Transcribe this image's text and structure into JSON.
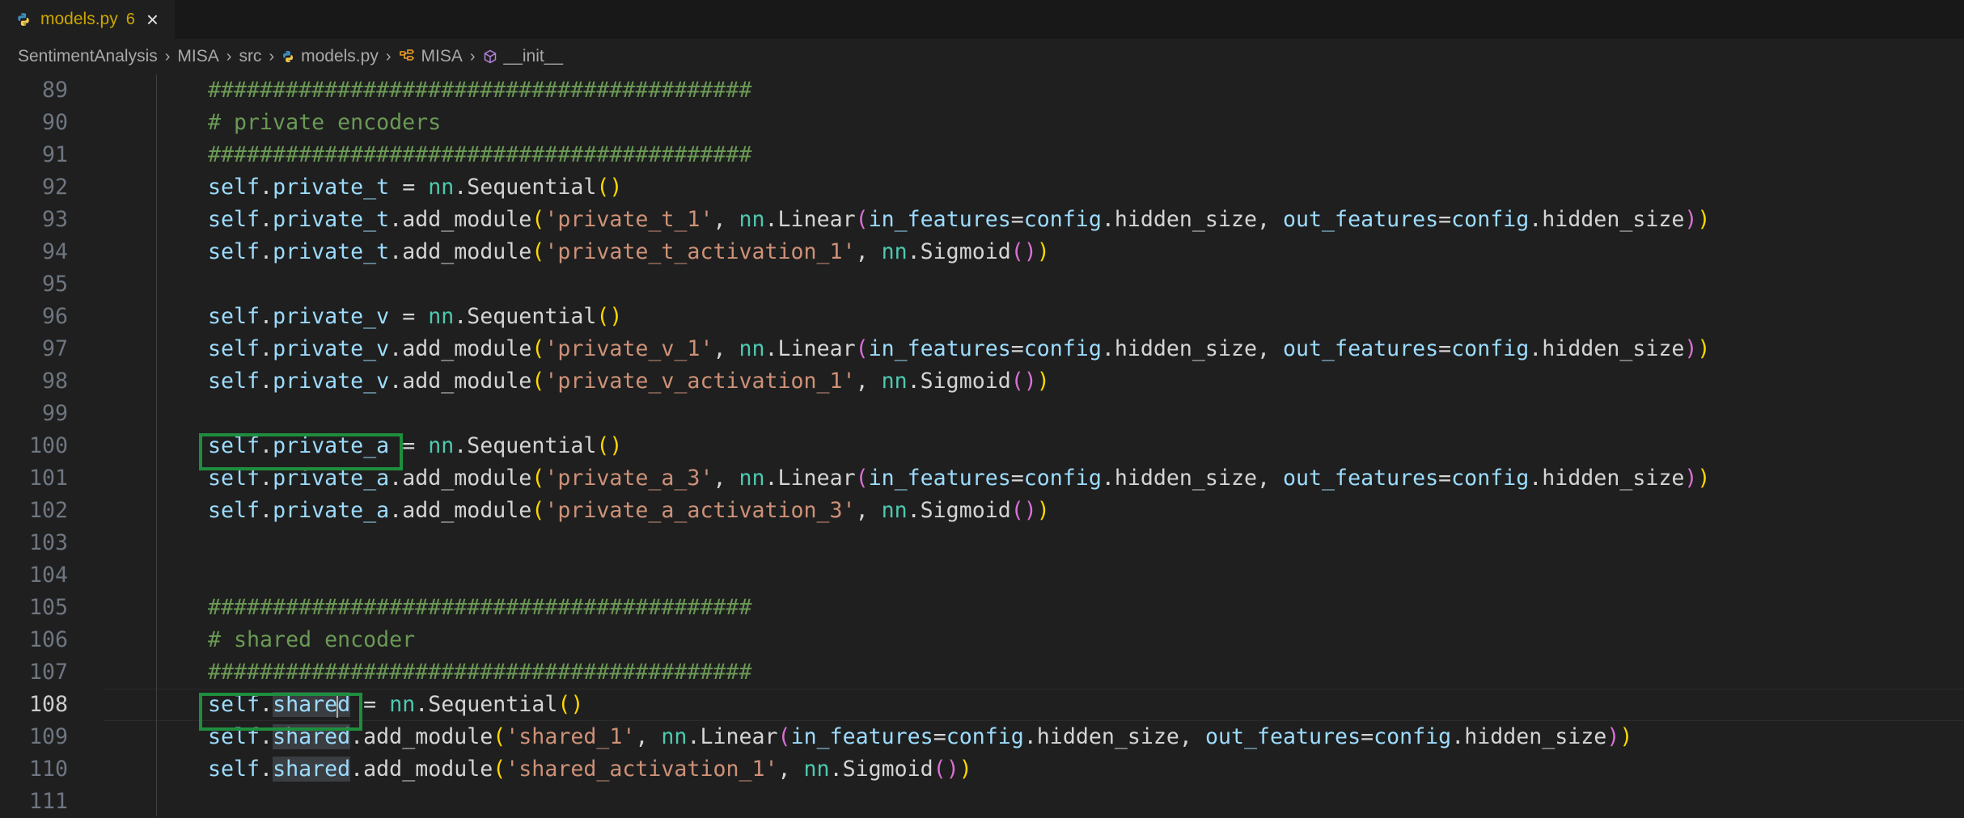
{
  "tab": {
    "file_name": "models.py",
    "problem_count": "6",
    "close_icon": "close-icon",
    "file_icon": "python-file-icon"
  },
  "breadcrumb": {
    "items": [
      "SentimentAnalysis",
      "MISA",
      "src",
      "models.py",
      "MISA",
      "__init__"
    ],
    "icons": [
      "",
      "",
      "",
      "python-file-icon",
      "class-icon",
      "method-icon"
    ]
  },
  "editor": {
    "current_line": 108,
    "lines": [
      {
        "num": "89",
        "text": "##########################################"
      },
      {
        "num": "90",
        "text": "# private encoders"
      },
      {
        "num": "91",
        "text": "##########################################"
      },
      {
        "num": "92",
        "text": "self.private_t = nn.Sequential()"
      },
      {
        "num": "93",
        "text": "self.private_t.add_module('private_t_1', nn.Linear(in_features=config.hidden_size, out_features=config.hidden_size))"
      },
      {
        "num": "94",
        "text": "self.private_t.add_module('private_t_activation_1', nn.Sigmoid())"
      },
      {
        "num": "95",
        "text": ""
      },
      {
        "num": "96",
        "text": "self.private_v = nn.Sequential()"
      },
      {
        "num": "97",
        "text": "self.private_v.add_module('private_v_1', nn.Linear(in_features=config.hidden_size, out_features=config.hidden_size))"
      },
      {
        "num": "98",
        "text": "self.private_v.add_module('private_v_activation_1', nn.Sigmoid())"
      },
      {
        "num": "99",
        "text": ""
      },
      {
        "num": "100",
        "text": "self.private_a = nn.Sequential()"
      },
      {
        "num": "101",
        "text": "self.private_a.add_module('private_a_3', nn.Linear(in_features=config.hidden_size, out_features=config.hidden_size))"
      },
      {
        "num": "102",
        "text": "self.private_a.add_module('private_a_activation_3', nn.Sigmoid())"
      },
      {
        "num": "103",
        "text": ""
      },
      {
        "num": "104",
        "text": ""
      },
      {
        "num": "105",
        "text": "##########################################"
      },
      {
        "num": "106",
        "text": "# shared encoder"
      },
      {
        "num": "107",
        "text": "##########################################"
      },
      {
        "num": "108",
        "text": "self.shared = nn.Sequential()"
      },
      {
        "num": "109",
        "text": "self.shared.add_module('shared_1', nn.Linear(in_features=config.hidden_size, out_features=config.hidden_size))"
      },
      {
        "num": "110",
        "text": "self.shared.add_module('shared_activation_1', nn.Sigmoid())"
      },
      {
        "num": "111",
        "text": ""
      }
    ]
  },
  "annotation_color": "#1e8e3e"
}
